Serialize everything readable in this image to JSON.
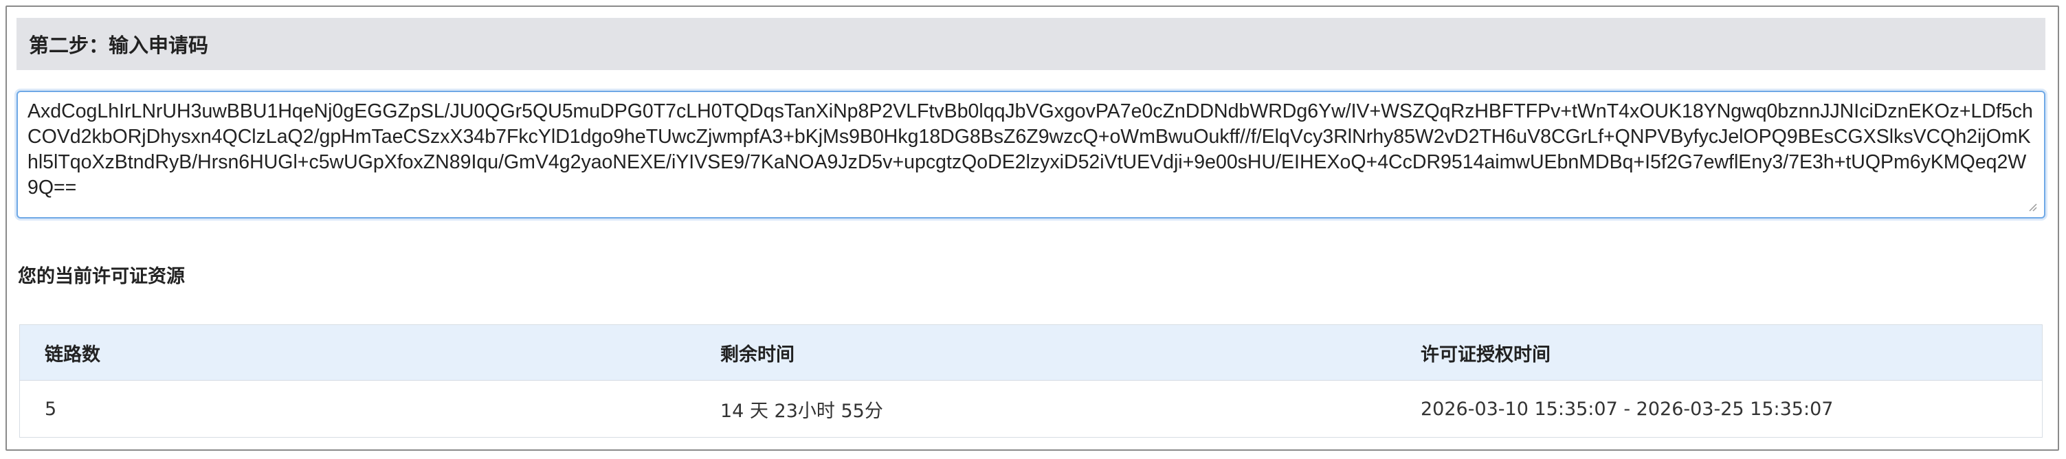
{
  "step": {
    "title": "第二步：输入申请码"
  },
  "request_code": {
    "value": "AxdCogLhIrLNrUH3uwBBU1HqeNj0gEGGZpSL/JU0QGr5QU5muDPG0T7cLH0TQDqsTanXiNp8P2VLFtvBb0lqqJbVGxgovPA7e0cZnDDNdbWRDg6Yw/IV+WSZQqRzHBFTFPv+tWnT4xOUK18YNgwq0bznnJJNIciDznEKOz+LDf5chCOVd2kbORjDhysxn4QClzLaQ2/gpHmTaeCSzxX34b7FkcYlD1dgo9heTUwcZjwmpfA3+bKjMs9B0Hkg18DG8BsZ6Z9wzcQ+oWmBwuOukff//f/ElqVcy3RlNrhy85W2vD2TH6uV8CGrLf+QNPVByfycJelOPQ9BEsCGXSlksVCQh2ijOmKhl5lTqoXzBtndRyB/Hrsn6HUGl+c5wUGpXfoxZN89Iqu/GmV4g2yaoNEXE/iYIVSE9/7KaNOA9JzD5v+upcgtzQoDE2lzyxiD52iVtUEVdji+9e00sHU/EIHEXoQ+4CcDR9514aimwUEbnMDBq+I5f2G7ewflEny3/7E3h+tUQPm6yKMQeq2W9Q=="
  },
  "resources": {
    "heading": "您的当前许可证资源",
    "columns": [
      "链路数",
      "剩余时间",
      "许可证授权时间"
    ],
    "rows": [
      [
        "5",
        "14 天 23小时 55分",
        "2026-03-10 15:35:07 - 2026-03-25 15:35:07"
      ]
    ]
  },
  "colors": {
    "header_bg": "#e2e3e7",
    "table_header_bg": "#e6f0fb",
    "focus_border": "#6ea8e6"
  }
}
